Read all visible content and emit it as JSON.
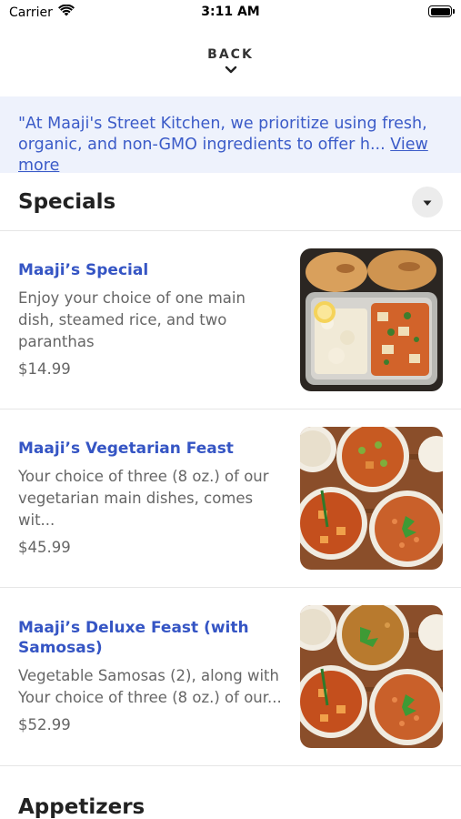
{
  "status_bar": {
    "carrier": "Carrier",
    "time": "3:11 AM"
  },
  "nav": {
    "back_label": "BACK"
  },
  "banner": {
    "text": "\"At Maaji's Street Kitchen, we prioritize using fresh, organic, and non-GMO ingredients to offer h...",
    "link": "View more",
    "background": "#eef2fc",
    "text_color": "#3b5bc8"
  },
  "sections": {
    "specials": {
      "title": "Specials",
      "items": [
        {
          "name": "Maaji’s Special",
          "description": "Enjoy your choice of one main dish, steamed rice, and two paranthas",
          "price": "$14.99",
          "photo": "tray-meal-photo"
        },
        {
          "name": "Maaji’s Vegetarian Feast",
          "description": "Your choice of three (8 oz.) of our vegetarian main dishes, comes wit...",
          "price": "$45.99",
          "photo": "curry-bowls-photo"
        },
        {
          "name": "Maaji’s Deluxe Feast (with Samosas)",
          "description": "Vegetable Samosas (2), along with Your choice of three (8 oz.) of our...",
          "price": "$52.99",
          "photo": "curry-bowls-photo"
        }
      ]
    },
    "appetizers": {
      "title": "Appetizers"
    }
  },
  "colors": {
    "accent": "#3555c4"
  }
}
